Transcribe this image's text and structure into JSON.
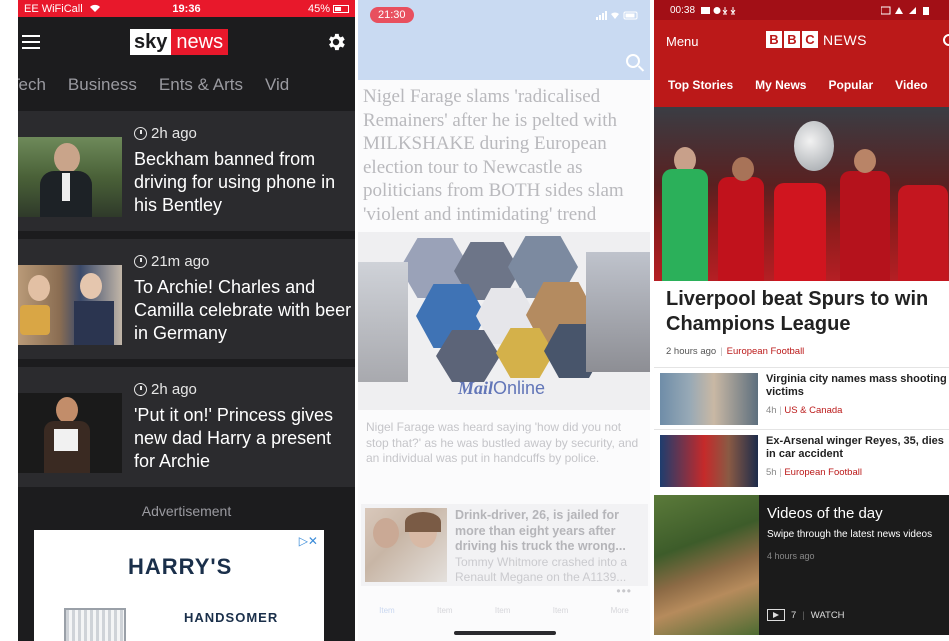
{
  "sky": {
    "status": {
      "carrier": "EE WiFiCall",
      "time": "19:36",
      "battery": "45%"
    },
    "logo": {
      "left": "sky",
      "right": "news"
    },
    "tabs": [
      "Tech",
      "Business",
      "Ents & Arts",
      "Vid"
    ],
    "stories": [
      {
        "time": "2h ago",
        "headline": "Beckham banned from driving for using phone in his Bentley"
      },
      {
        "time": "21m ago",
        "headline": "To Archie! Charles and Camilla celebrate with beer in Germany"
      },
      {
        "time": "2h ago",
        "headline": "'Put it on!' Princess gives new dad Harry a present for Archie"
      }
    ],
    "ad": {
      "label": "Advertisement",
      "brand": "HARRY'S",
      "tagline": "HANDSOMER",
      "choices": "▷✕"
    },
    "icons": [
      "menu-icon",
      "gear-icon",
      "clock-icon",
      "wifi-icon",
      "battery-icon"
    ]
  },
  "mail": {
    "status": {
      "time": "21:30"
    },
    "headline": "Nigel Farage slams 'radicalised Remainers' after he is pelted with MILKSHAKE during European election tour to Newcastle as politicians from BOTH sides slam 'violent and intimidating' trend",
    "logo": {
      "bold": "Mail",
      "rest": "Online"
    },
    "subtext": "Nigel Farage was heard saying 'how did you not stop that?' as he was bustled away by security, and an individual was put in handcuffs by police.",
    "story": {
      "title": "Drink-driver, 26, is jailed for more than eight years after driving his truck the wrong...",
      "body": "Tommy Whitmore crashed into a Renault Megane on the A1139..."
    },
    "tabs": [
      "Item",
      "Item",
      "Item",
      "Item",
      "More"
    ],
    "icons": [
      "search-icon"
    ]
  },
  "bbc": {
    "status": {
      "time": "00:38"
    },
    "menu": "Menu",
    "logo": {
      "letters": [
        "B",
        "B",
        "C"
      ],
      "word": "NEWS"
    },
    "tabs": [
      "Top Stories",
      "My News",
      "Popular",
      "Video"
    ],
    "lead": {
      "headline": "Liverpool beat Spurs to win Champions League",
      "time": "2 hours ago",
      "section": "European Football"
    },
    "rows": [
      {
        "title": "Virginia city names mass shooting victims",
        "time": "4h",
        "section": "US & Canada"
      },
      {
        "title": "Ex-Arsenal winger Reyes, 35, dies in car accident",
        "time": "5h",
        "section": "European Football"
      }
    ],
    "video": {
      "title": "Videos of the day",
      "sub": "Swipe through the latest news videos",
      "time": "4 hours ago",
      "count": "7",
      "watch": "WATCH"
    },
    "colors": {
      "brand": "#bb1919"
    },
    "icons": [
      "search-icon",
      "play-icon"
    ]
  },
  "colors": {
    "sky_red": "#e8182b",
    "sky_bg": "#1c1c1e",
    "mail_blue": "#c9daf2",
    "bbc_red": "#bb1919"
  }
}
